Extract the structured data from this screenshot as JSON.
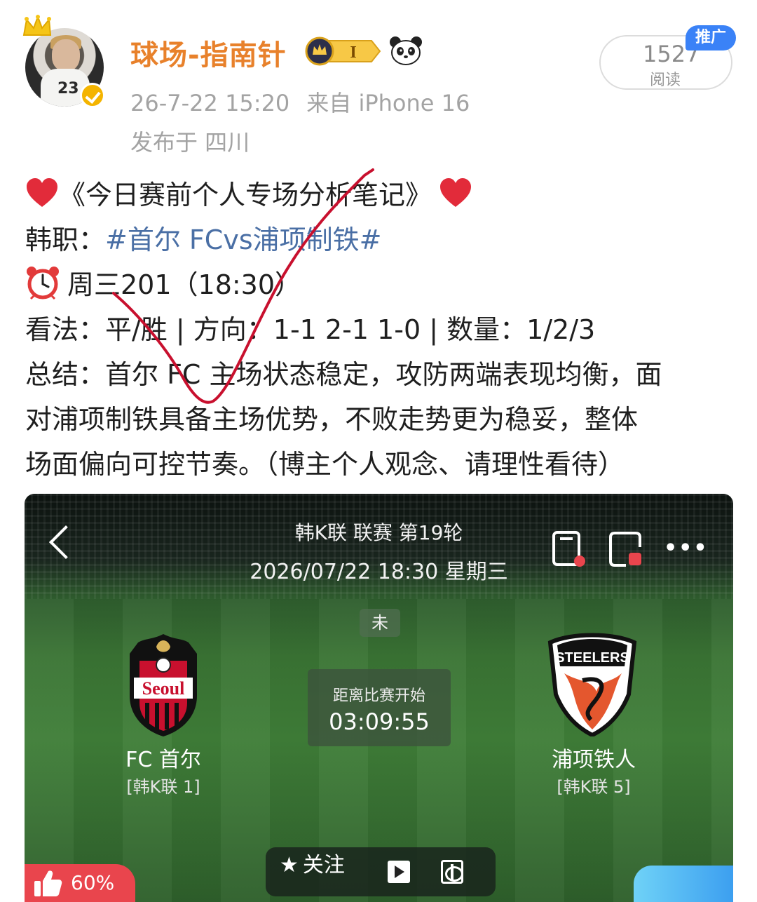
{
  "header": {
    "username": "球场-指南针",
    "level_badge": "I",
    "timestamp": "26-7-22 15:20",
    "source": "来自 iPhone 16",
    "location": "发布于 四川",
    "read_count": "1527",
    "read_label": "阅读",
    "promo_tag": "推广"
  },
  "post": {
    "title": "《今日赛前个人专场分析笔记》",
    "league_prefix": "韩职：",
    "hashtag": "#首尔 FCvs浦项制铁#",
    "match_time": "周三201（18:30）",
    "view_line": "看法：平/胜 | 方向：1-1 2-1 1-0 | 数量：1/2/3",
    "summary_line1": "总结：首尔 FC 主场状态稳定，攻防两端表现均衡，面",
    "summary_line2": "对浦项制铁具备主场优势，不败走势更为稳妥，整体",
    "summary_line3": "场面偏向可控节奏。（博主个人观念、请理性看待）"
  },
  "match_card": {
    "league": "韩K联 联赛 第19轮",
    "datetime": "2026/07/22 18:30 星期三",
    "status": "未",
    "countdown_label": "距离比赛开始",
    "countdown": "03:09:55",
    "home_team": "FC 首尔",
    "home_rank": "[韩K联 1]",
    "home_logo_text": "Seoul",
    "away_team": "浦项铁人",
    "away_rank": "[韩K联 5]",
    "away_logo_text": "STEELERS",
    "follow_label": "关注",
    "like_percent": "60%"
  },
  "colors": {
    "username": "#e8812b",
    "hashtag": "#4a6fa5",
    "meta": "#a3a3a3",
    "promo": "#3a82f7",
    "like_chip": "#e9454d",
    "check_mark": "#c8102e"
  },
  "icons": [
    "crown-icon",
    "verified-icon",
    "level-badge-icon",
    "panda-icon",
    "heart-icon",
    "alarm-clock-icon",
    "back-chevron-icon",
    "phone-icon",
    "window-icon",
    "more-icon",
    "star-icon",
    "play-icon",
    "share-icon",
    "thumbs-up-icon"
  ]
}
